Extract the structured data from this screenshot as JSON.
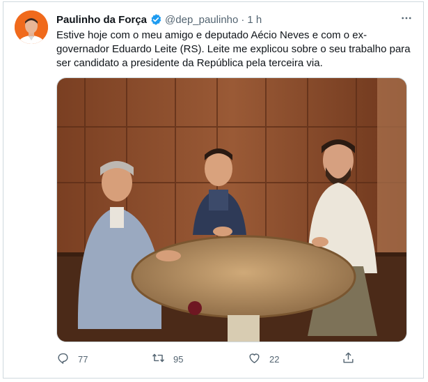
{
  "tweet": {
    "author_name": "Paulinho da Força",
    "handle": "@dep_paulinho",
    "separator": "·",
    "time": "1 h",
    "text": "Estive hoje com o meu amigo e deputado Aécio Neves e com o ex-\ngovernador Eduardo Leite (RS). Leite me explicou sobre o seu trabalho para\nser candidato a presidente da República pela terceira via.",
    "verified_color": "#1d9bf0"
  },
  "actions": {
    "reply_count": "77",
    "retweet_count": "95",
    "like_count": "22"
  },
  "icons": {
    "more": "more-horizontal-icon",
    "reply": "reply-icon",
    "retweet": "retweet-icon",
    "like": "heart-icon",
    "share": "share-icon"
  }
}
